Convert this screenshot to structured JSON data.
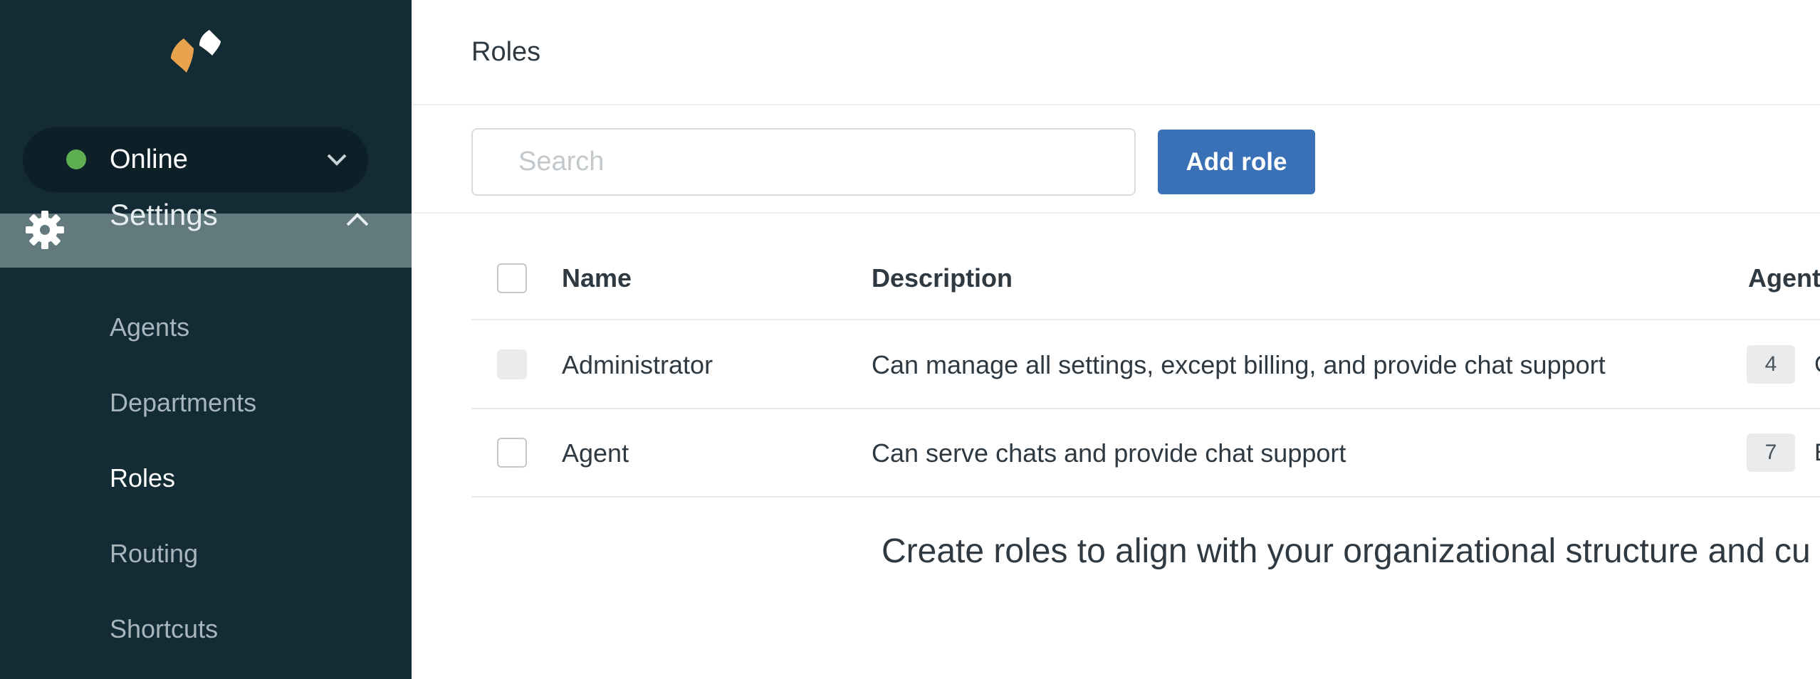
{
  "sidebar": {
    "logo_icon": "zendesk-chat-logo",
    "status": {
      "label": "Online",
      "color": "#5eae52"
    },
    "settings": {
      "label": "Settings"
    },
    "items": [
      {
        "label": "Agents"
      },
      {
        "label": "Departments"
      },
      {
        "label": "Roles",
        "active": true
      },
      {
        "label": "Routing"
      },
      {
        "label": "Shortcuts"
      }
    ]
  },
  "header": {
    "title": "Roles"
  },
  "toolbar": {
    "search_placeholder": "Search",
    "search_value": "",
    "add_label": "Add role"
  },
  "table": {
    "columns": [
      "Name",
      "Description",
      "Agent"
    ],
    "rows": [
      {
        "name": "Administrator",
        "description": "Can manage all settings, except billing, and provide chat support",
        "agents": "4",
        "trail": "C",
        "checkbox_disabled": true
      },
      {
        "name": "Agent",
        "description": "Can serve chats and provide chat support",
        "agents": "7",
        "trail": "E",
        "checkbox_disabled": false
      }
    ]
  },
  "footer": {
    "text": "Create roles to align with your organizational structure and cu"
  },
  "colors": {
    "sidebar_bg": "#132b34",
    "accent": "#3a70b5",
    "settings_highlight": "#627a7e",
    "logo_orange": "#e9a24d"
  }
}
